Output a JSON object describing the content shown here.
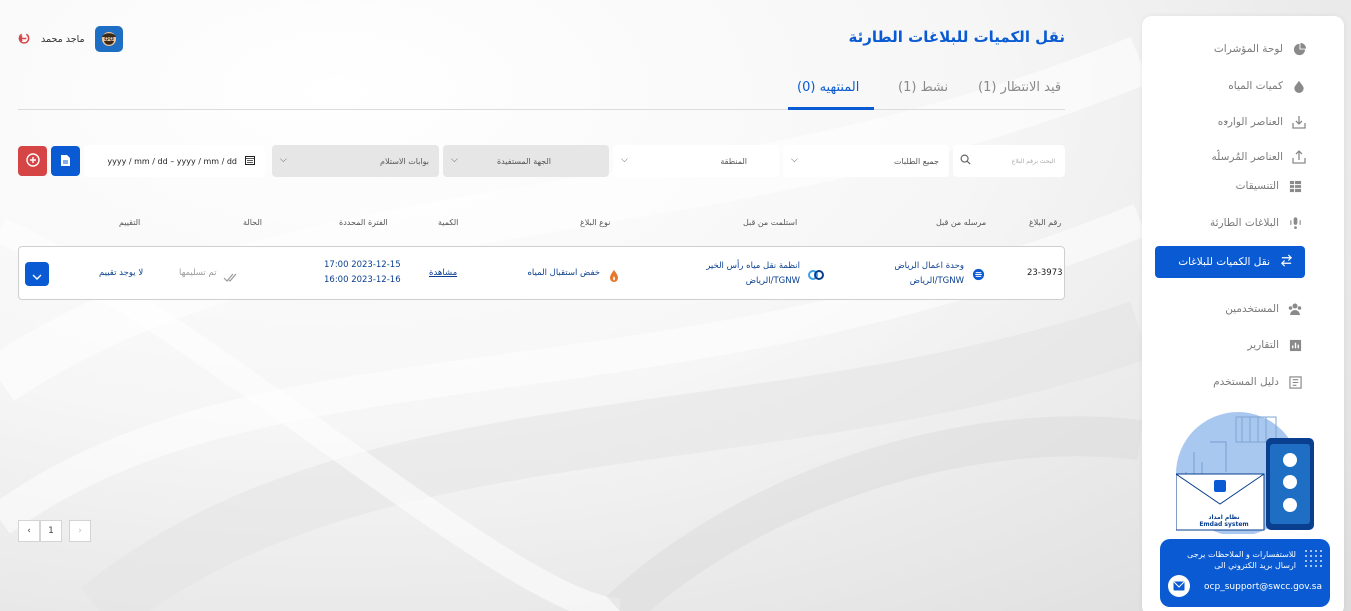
{
  "header": {
    "page_title": "نقل الكميات للبلاغات الطارئة",
    "user_name": "ماجد محمد"
  },
  "sidebar": {
    "items": [
      {
        "label": "لوحة المؤشرات",
        "icon": "pie-chart-icon"
      },
      {
        "label": "كميات المياه",
        "icon": "water-drop-icon"
      },
      {
        "label": "العناصر الوارده",
        "icon": "inbox-download-icon"
      },
      {
        "label": "العناصر المُرسله",
        "icon": "outbox-upload-icon"
      },
      {
        "label": "التنسيقات",
        "icon": "table-icon"
      },
      {
        "label": "البلاغات الطارئة",
        "icon": "alert-icon"
      },
      {
        "label": "نقل الكميات للبلاغات",
        "icon": "transfer-icon"
      },
      {
        "label": "المستخدمين",
        "icon": "users-icon"
      },
      {
        "label": "التقارير",
        "icon": "report-icon"
      },
      {
        "label": "دليل المستخدم",
        "icon": "guide-icon"
      }
    ],
    "promo": {
      "system_ar": "نظام امداد",
      "system_en": "Emdad system"
    },
    "support": {
      "text": "للاستفسارات و الملاحظات يرجى ارسال بريد الكتروني الى",
      "email": "ocp_support@swcc.gov.sa"
    }
  },
  "tabs": [
    {
      "label": "قيد الانتظار (1)",
      "active": false
    },
    {
      "label": "نشط (1)",
      "active": false
    },
    {
      "label": "المنتهيه (0)",
      "active": true
    }
  ],
  "filters": {
    "search_placeholder": "البحث برقم البلاغ",
    "requests": "جميع الطلبات",
    "region": "المنطقة",
    "beneficiary": "الجهة المستفيدة",
    "gates": "بوابات الاستلام",
    "date_range": "yyyy / mm / dd – yyyy / mm / dd"
  },
  "table": {
    "headers": [
      "رقم البلاغ",
      "مرسله من قبل",
      "استلمت من قبل",
      "نوع البلاغ",
      "الكمية",
      "الفترة المحددة",
      "الحالة",
      "التقييم"
    ],
    "rows": [
      {
        "number": "23-3973",
        "sender_1": "وحدة اعمال الرياض",
        "sender_2": "TGNW/الرياض",
        "receiver_1": "انظمة نقل مياه رأس الخير",
        "receiver_2": "TGNW/الرياض",
        "type": "خفض استقبال المياه",
        "quantity": "مشاهدة",
        "period_1": "2023-12-15 17:00",
        "period_2": "2023-12-16 16:00",
        "status": "تم تسليمها",
        "rating": "لا يوجد تقييم"
      }
    ]
  },
  "pagination": {
    "current_page": "1"
  },
  "colors": {
    "primary": "#0a5bd3",
    "danger": "#d64545",
    "title": "#0a5bd3"
  }
}
